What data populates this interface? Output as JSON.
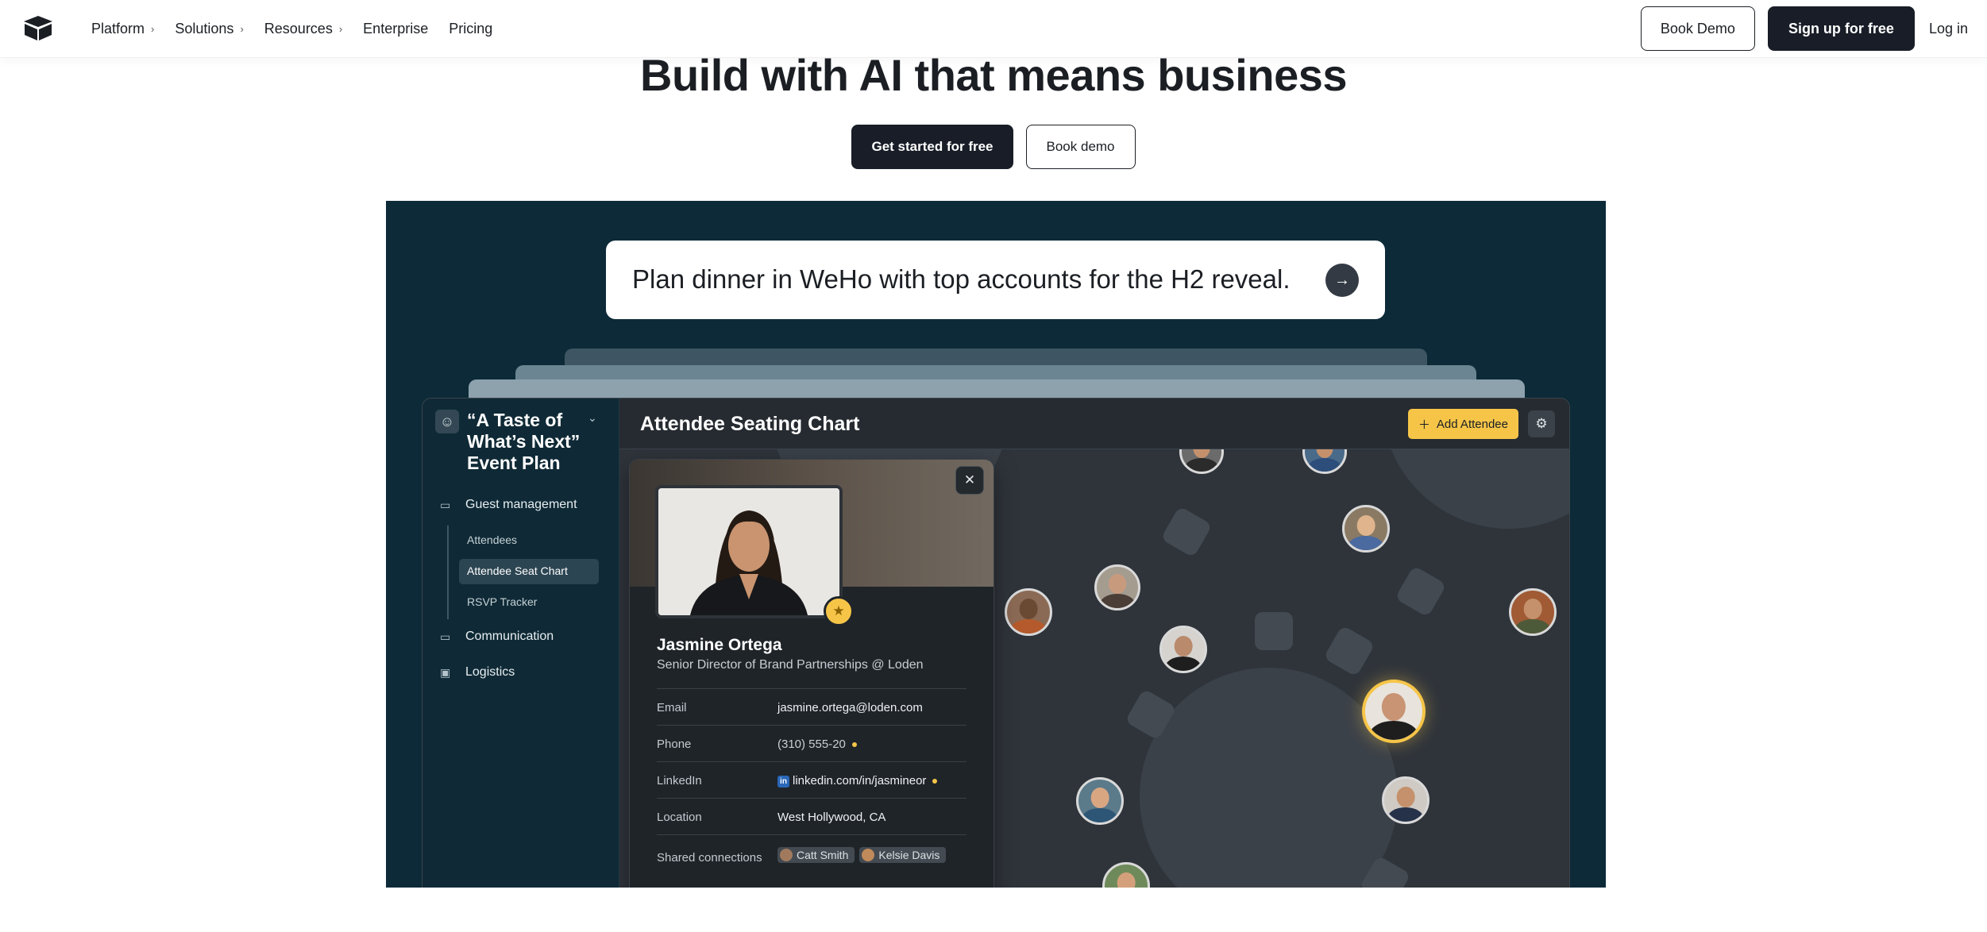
{
  "nav": {
    "links": [
      {
        "label": "Platform",
        "chevron": true
      },
      {
        "label": "Solutions",
        "chevron": true
      },
      {
        "label": "Resources",
        "chevron": true
      },
      {
        "label": "Enterprise",
        "chevron": false
      },
      {
        "label": "Pricing",
        "chevron": false
      }
    ],
    "book_demo": "Book Demo",
    "sign_up": "Sign up for free",
    "log_in": "Log in"
  },
  "hero": {
    "title": "Build with AI that means business",
    "primary_cta": "Get started for free",
    "secondary_cta": "Book demo"
  },
  "demo": {
    "prompt": "Plan dinner in WeHo with top accounts for the H2 reveal.",
    "sidebar": {
      "title": "“A Taste of What’s Next” Event Plan",
      "sections": [
        "Guest management",
        "Communication",
        "Logistics"
      ],
      "sub_items": [
        "Attendees",
        "Attendee Seat Chart",
        "RSVP Tracker"
      ],
      "active_sub": "Attendee Seat Chart"
    },
    "main_title": "Attendee Seating Chart",
    "add_button": "Add Attendee",
    "profile": {
      "name": "Jasmine Ortega",
      "role": "Senior Director of Brand Partnerships @ Loden",
      "fields": {
        "email_label": "Email",
        "email": "jasmine.ortega@loden.com",
        "phone_label": "Phone",
        "phone": "(310) 555-20",
        "linkedin_label": "LinkedIn",
        "linkedin": "linkedin.com/in/jasmineor",
        "location_label": "Location",
        "location": "West Hollywood, CA",
        "connections_label": "Shared connections",
        "connections": [
          "Catt Smith",
          "Kelsie Davis"
        ]
      }
    }
  },
  "colors": {
    "brand_dark": "#181d27",
    "demo_bg": "#0c2a38",
    "accent_yellow": "#f6c548"
  },
  "icons": {
    "logo": "cube-logo-icon",
    "prompt_submit": "arrow-right-icon",
    "close": "close-icon",
    "gear": "gear-icon",
    "favorite": "star-icon"
  }
}
